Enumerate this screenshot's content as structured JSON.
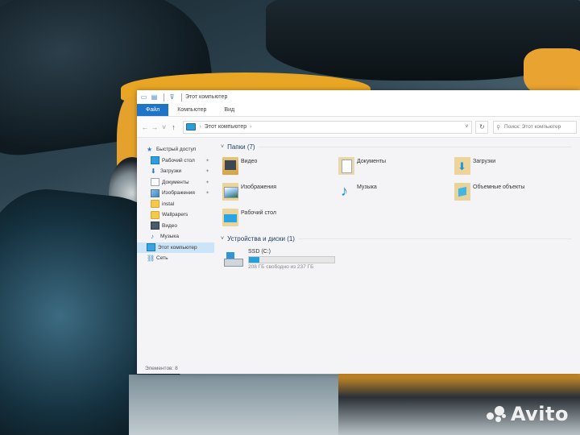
{
  "window": {
    "title": "Этот компьютер",
    "qa_pin": "⊽"
  },
  "ribbon": {
    "tabs": [
      {
        "label": "Файл"
      },
      {
        "label": "Компьютер"
      },
      {
        "label": "Вид"
      }
    ]
  },
  "address": {
    "path_label": "Этот компьютер",
    "search_placeholder": "Поиск: Этот компьютер"
  },
  "sidebar": {
    "items": [
      {
        "label": "Быстрый доступ",
        "icon": "star-icon"
      },
      {
        "label": "Рабочий стол",
        "icon": "desktop-icon",
        "pinned": true
      },
      {
        "label": "Загрузки",
        "icon": "download-icon",
        "pinned": true
      },
      {
        "label": "Документы",
        "icon": "document-icon",
        "pinned": true
      },
      {
        "label": "Изображения",
        "icon": "image-icon",
        "pinned": true
      },
      {
        "label": "instal",
        "icon": "folder-icon"
      },
      {
        "label": "Wallpapers",
        "icon": "folder-icon"
      },
      {
        "label": "Видео",
        "icon": "video-icon"
      },
      {
        "label": "Музыка",
        "icon": "music-icon"
      },
      {
        "label": "Этот компьютер",
        "icon": "computer-icon",
        "active": true
      },
      {
        "label": "Сеть",
        "icon": "network-icon"
      }
    ]
  },
  "content": {
    "folders_header": "Папки (7)",
    "folders": [
      {
        "label": "Видео",
        "icon": "video-folder-icon"
      },
      {
        "label": "Документы",
        "icon": "documents-folder-icon"
      },
      {
        "label": "Загрузки",
        "icon": "downloads-folder-icon"
      },
      {
        "label": "Изображения",
        "icon": "pictures-folder-icon"
      },
      {
        "label": "Музыка",
        "icon": "music-folder-icon"
      },
      {
        "label": "Объемные объекты",
        "icon": "3d-objects-folder-icon"
      },
      {
        "label": "Рабочий стол",
        "icon": "desktop-folder-icon"
      }
    ],
    "drives_header": "Устройства и диски (1)",
    "drive": {
      "name": "SSD (C:)",
      "free_text": "208 ГБ свободно из 237 ГБ",
      "used_fraction": 0.12,
      "bar_color": "#26a0da"
    }
  },
  "status": {
    "items_text": "Элементов: 8"
  },
  "watermark": {
    "text": "Avito"
  }
}
